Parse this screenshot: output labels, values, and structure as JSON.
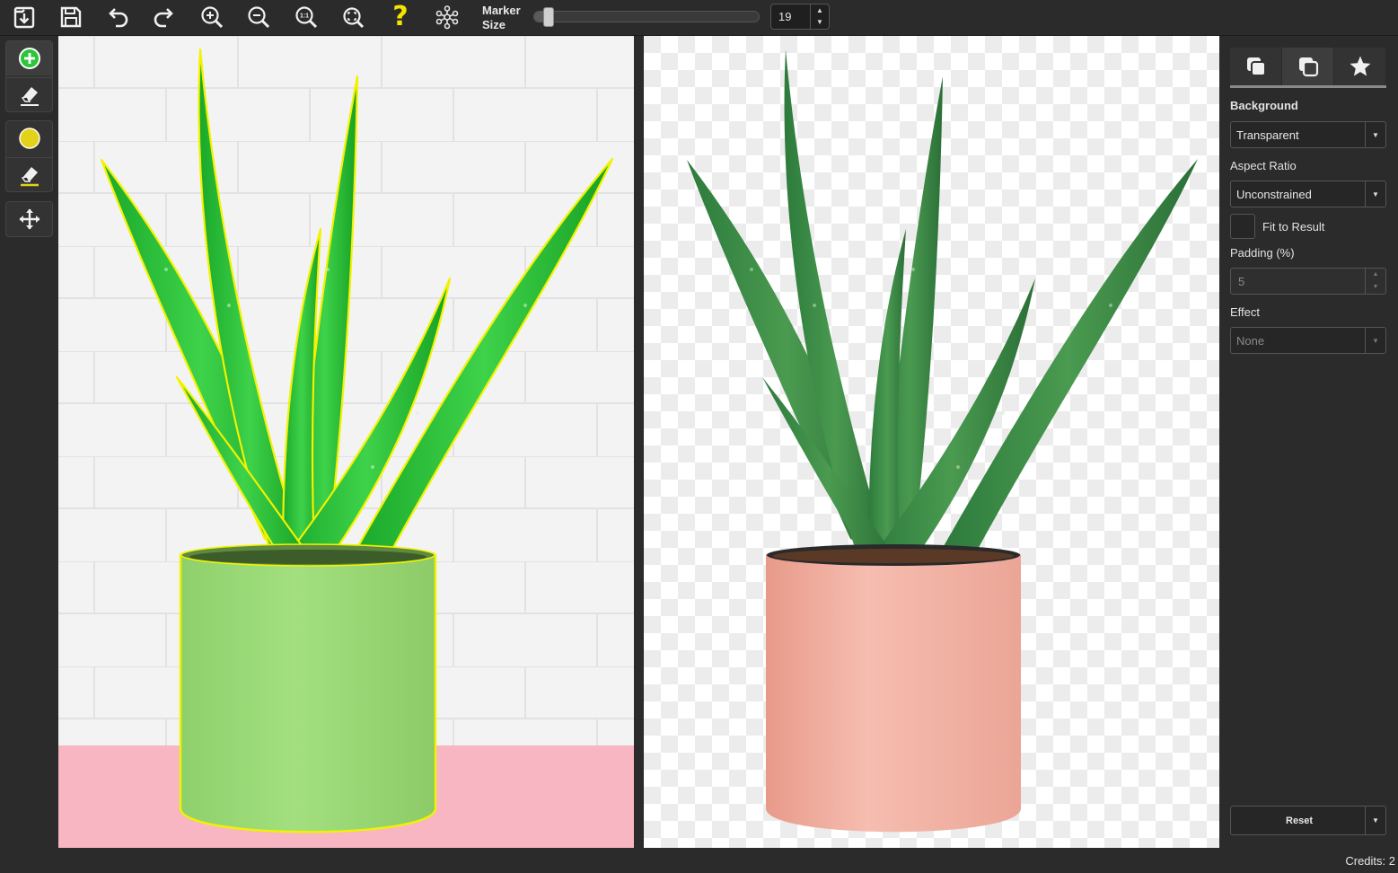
{
  "toolbar": {
    "buttons": [
      {
        "id": "open",
        "icon": "open-image-icon"
      },
      {
        "id": "save",
        "icon": "save-icon"
      },
      {
        "id": "undo",
        "icon": "undo-icon"
      },
      {
        "id": "redo",
        "icon": "redo-icon"
      },
      {
        "id": "zoom-in",
        "icon": "zoom-in-icon"
      },
      {
        "id": "zoom-out",
        "icon": "zoom-out-icon"
      },
      {
        "id": "zoom-actual",
        "icon": "zoom-1-1-icon",
        "text": "1:1"
      },
      {
        "id": "zoom-fit",
        "icon": "zoom-fit-icon"
      },
      {
        "id": "help",
        "icon": "help-question-icon",
        "text": "?"
      },
      {
        "id": "network",
        "icon": "network-icon"
      }
    ],
    "marker_label": "Marker Size",
    "marker_value": "19",
    "marker_fraction": 0.04,
    "help_color": "#f5e400"
  },
  "left_tools": [
    {
      "name": "foreground-marker",
      "icon": "add-circle-icon",
      "color": "#2ec43c"
    },
    {
      "name": "foreground-eraser",
      "icon": "eraser-icon"
    },
    {
      "name": "edge-marker",
      "icon": "yellow-circle-icon",
      "color": "#e3d11a"
    },
    {
      "name": "edge-eraser",
      "icon": "eraser-yellow-icon"
    },
    {
      "name": "pan",
      "icon": "move-arrows-icon"
    }
  ],
  "panel": {
    "tabs": [
      "foreground-icon",
      "background-icon",
      "star-icon"
    ],
    "background_label": "Background",
    "background_value": "Transparent",
    "aspect_label": "Aspect Ratio",
    "aspect_value": "Unconstrained",
    "fit_label": "Fit to Result",
    "padding_label": "Padding (%)",
    "padding_value": "5",
    "effect_label": "Effect",
    "effect_value": "None",
    "reset_label": "Reset"
  },
  "status": {
    "credits": "Credits: 2"
  },
  "colors": {
    "app_bg": "#2b2b2b",
    "outline_yellow": "#f2f200",
    "overlay_green": "#2ec43c",
    "pot_pink": "#f2b3a3"
  }
}
